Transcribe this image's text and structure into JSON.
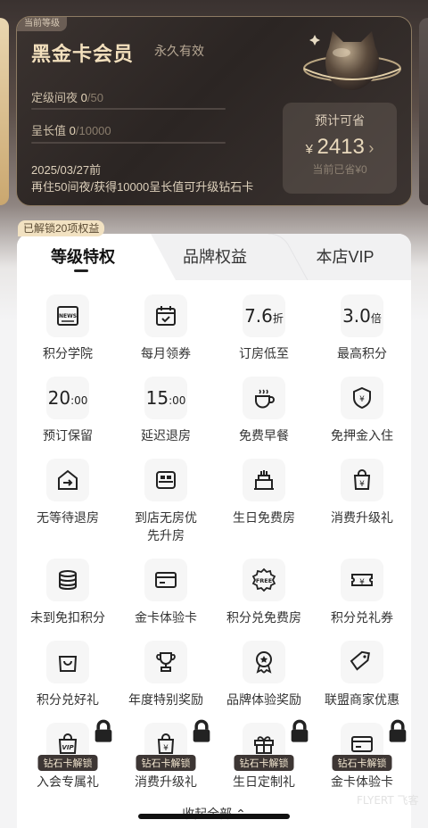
{
  "card": {
    "current_tag": "当前等级",
    "title": "黑金卡会员",
    "validity": "永久有效",
    "nights_label": "定级间夜",
    "nights_current": "0",
    "nights_total": "/50",
    "growth_label": "呈长值",
    "growth_current": "0",
    "growth_total": "/10000",
    "expiry": "2025/03/27前",
    "upgrade_hint": "再住50间夜/获得10000呈长值可升级钻石卡",
    "save_label": "预计可省",
    "save_currency": "¥",
    "save_amount": "2413",
    "save_sub": "当前已省¥0"
  },
  "unlocked_tag": "已解锁20项权益",
  "tabs": [
    {
      "label": "等级特权"
    },
    {
      "label": "品牌权益"
    },
    {
      "label": "本店VIP"
    }
  ],
  "benefits": [
    {
      "label": "积分学院",
      "icon": "news-icon"
    },
    {
      "label": "每月领券",
      "icon": "calendar-icon"
    },
    {
      "label": "订房低至",
      "icon": "discount-icon",
      "value": "7.6",
      "unit": "折"
    },
    {
      "label": "最高积分",
      "icon": "multiplier-icon",
      "value": "3.0",
      "unit": "倍"
    },
    {
      "label": "预订保留",
      "icon": "time-icon",
      "value": "20",
      "unit": ":00"
    },
    {
      "label": "延迟退房",
      "icon": "time-icon",
      "value": "15",
      "unit": ":00"
    },
    {
      "label": "免费早餐",
      "icon": "coffee-icon"
    },
    {
      "label": "免押金入住",
      "icon": "shield-yen-icon"
    },
    {
      "label": "无等待退房",
      "icon": "exit-icon"
    },
    {
      "label": "到店无房优先升房",
      "icon": "bed-icon"
    },
    {
      "label": "生日免费房",
      "icon": "cake-icon"
    },
    {
      "label": "消费升级礼",
      "icon": "bag-yen-icon"
    },
    {
      "label": "未到免扣积分",
      "icon": "coins-icon"
    },
    {
      "label": "金卡体验卡",
      "icon": "card-icon"
    },
    {
      "label": "积分兑免费房",
      "icon": "free-badge-icon"
    },
    {
      "label": "积分兑礼券",
      "icon": "ticket-yen-icon"
    },
    {
      "label": "积分兑好礼",
      "icon": "shopping-bag-icon"
    },
    {
      "label": "年度特别奖励",
      "icon": "trophy-icon"
    },
    {
      "label": "品牌体验奖励",
      "icon": "medal-icon"
    },
    {
      "label": "联盟商家优惠",
      "icon": "tag-icon"
    },
    {
      "label": "入会专属礼",
      "icon": "vip-bag-icon",
      "badge": "钻石卡解锁"
    },
    {
      "label": "消费升级礼",
      "icon": "bag-yen-icon",
      "badge": "钻石卡解锁"
    },
    {
      "label": "生日定制礼",
      "icon": "gift-icon",
      "badge": "钻石卡解锁"
    },
    {
      "label": "金卡体验卡",
      "icon": "card-icon",
      "badge": "钻石卡解锁"
    }
  ],
  "collapse_label": "收起全部",
  "watermark": "FLYERT 飞客",
  "colors": {
    "gold": "#cda96e",
    "dark": "#2b2523",
    "badge": "#3d3634"
  }
}
